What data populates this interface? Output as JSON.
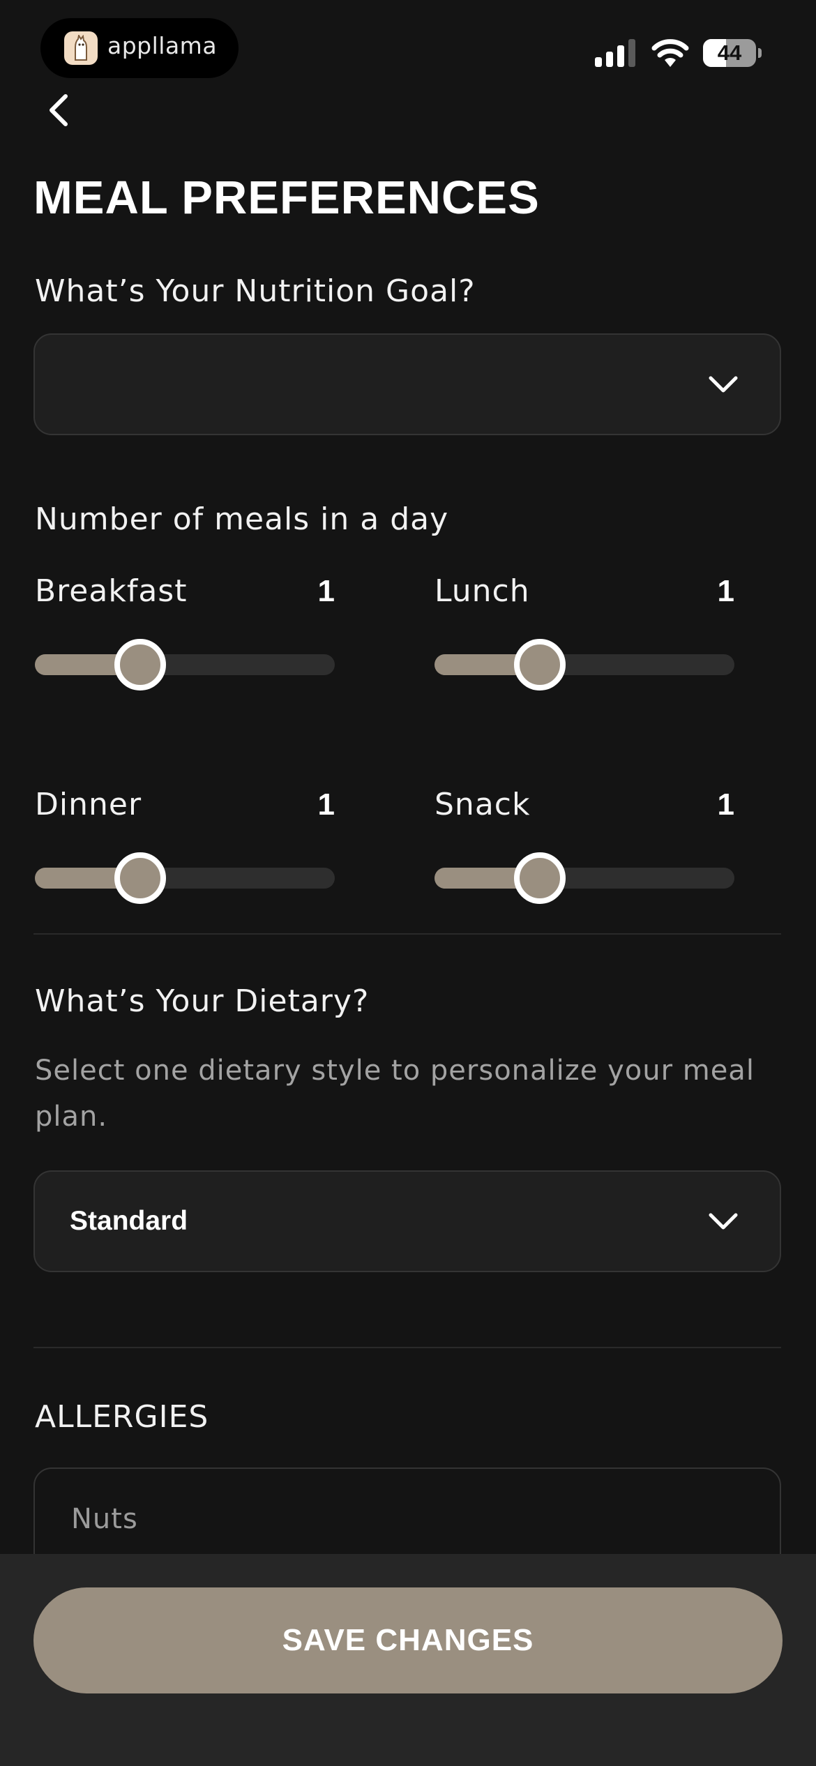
{
  "status_bar": {
    "app_name": "appllama",
    "battery_level": "44",
    "battery_fraction": 0.44,
    "signal_icon": "cellular-signal-icon",
    "wifi_icon": "wifi-icon"
  },
  "nav": {
    "back_icon": "chevron-left-icon"
  },
  "page": {
    "title": "MEAL PREFERENCES"
  },
  "nutrition_goal": {
    "label": "What’s Your Nutrition Goal?",
    "value": "",
    "icon": "chevron-down-icon"
  },
  "meals": {
    "label": "Number of meals in a day",
    "items": [
      {
        "label": "Breakfast",
        "value": "1",
        "fraction": 0.35
      },
      {
        "label": "Lunch",
        "value": "1",
        "fraction": 0.35
      },
      {
        "label": "Dinner",
        "value": "1",
        "fraction": 0.35
      },
      {
        "label": "Snack",
        "value": "1",
        "fraction": 0.35
      }
    ]
  },
  "dietary": {
    "label": "What’s Your Dietary?",
    "helper": "Select one dietary style to personalize your meal plan.",
    "value": "Standard",
    "icon": "chevron-down-icon"
  },
  "allergies": {
    "label": "ALLERGIES",
    "placeholder": "Nuts"
  },
  "footer": {
    "save_label": "SAVE CHANGES"
  },
  "colors": {
    "background": "#141414",
    "accent": "#9a8f80",
    "track": "#2e2e2e",
    "field": "#1f1f1f",
    "footer": "#262626"
  }
}
